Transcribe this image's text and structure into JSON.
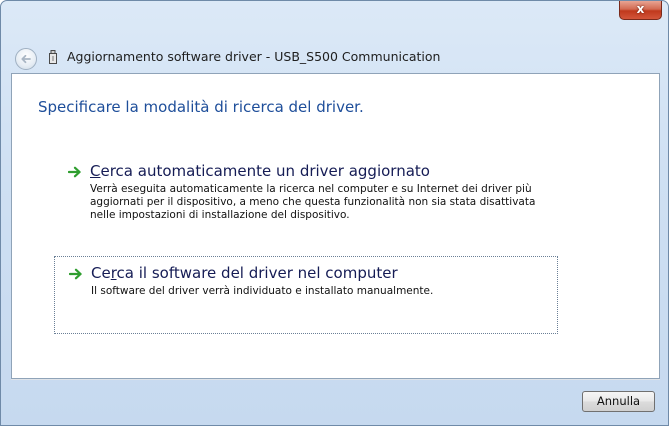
{
  "window": {
    "close_glyph": "x",
    "title": "Aggiornamento software driver - USB_S500 Communication"
  },
  "icons": {
    "back": "back-arrow-icon",
    "device": "usb-device-icon",
    "option": "green-arrow-icon",
    "close": "close-icon"
  },
  "colors": {
    "heading": "#1e4e9a",
    "option_title": "#151c55",
    "arrow": "#2f9e2f",
    "close_button": "#c0391d"
  },
  "main": {
    "heading": "Specificare la modalità di ricerca del driver.",
    "options": [
      {
        "title_prefix": "",
        "title_accel": "C",
        "title_rest": "erca automaticamente un driver aggiornato",
        "description": "Verrà eseguita automaticamente la ricerca nel  computer e su Internet dei driver più aggiornati per il dispositivo, a meno che questa funzionalità non sia stata disattivata nelle impostazioni di installazione del dispositivo."
      },
      {
        "title_prefix": "Ce",
        "title_accel": "r",
        "title_rest": "ca il software del driver nel computer",
        "description": "Il software del driver verrà individuato e installato manualmente."
      }
    ]
  },
  "footer": {
    "cancel_label": "Annulla"
  }
}
